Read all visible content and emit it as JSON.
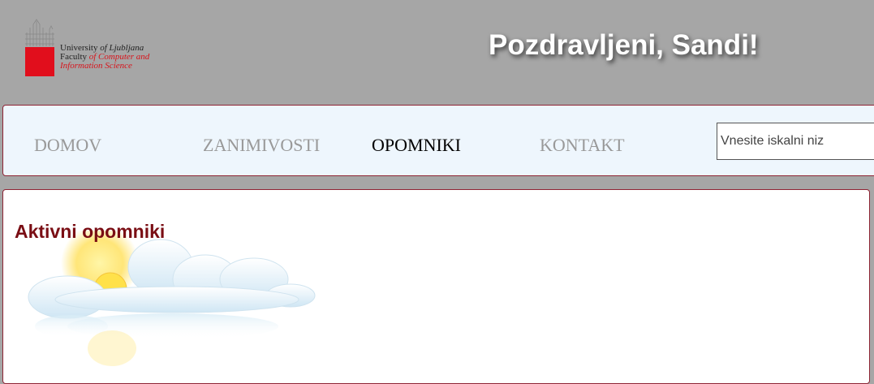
{
  "header": {
    "logo": {
      "line1_prefix": "University ",
      "line1_italic": "of Ljubljana",
      "line2_prefix": "Faculty ",
      "line2_italic": "of Computer and",
      "line3_italic": "Information Science",
      "colors": {
        "red": "#e10e1c",
        "text": "#222222"
      }
    },
    "greeting": "Pozdravljeni, Sandi!"
  },
  "nav": {
    "items": [
      {
        "label": "DOMOV",
        "active": false
      },
      {
        "label": "ZANIMIVOSTI",
        "active": false
      },
      {
        "label": "OPOMNIKI",
        "active": true
      },
      {
        "label": "KONTAKT",
        "active": false
      }
    ],
    "search": {
      "placeholder": "Vnesite iskalni niz",
      "value": ""
    }
  },
  "main": {
    "title": "Aktivni opomniki",
    "weather_icon": "partly-sunny-icon"
  },
  "colors": {
    "page_bg": "#a6a6a6",
    "nav_bg": "#eef6fd",
    "border": "#8e2434",
    "title": "#7a0e14",
    "nav_inactive": "#999999",
    "nav_active": "#000000"
  }
}
